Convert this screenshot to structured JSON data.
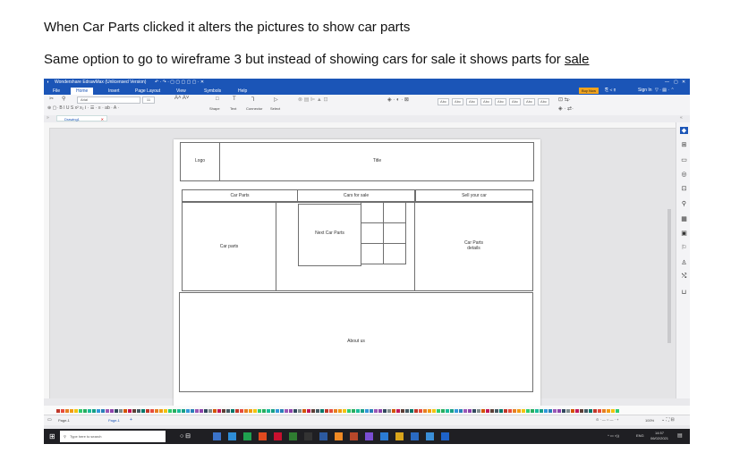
{
  "doc": {
    "line1": "When Car Parts clicked it alters the pictures to show car parts",
    "line2_pre": "Same option to go to wireframe 3 but instead of showing cars for sale it shows parts for ",
    "line2_ul": "sale"
  },
  "app": {
    "title": "Wondershare EdrawMax (Unlicensed Version)",
    "menu": [
      "File",
      "Home",
      "Insert",
      "Page Layout",
      "View",
      "Symbols",
      "Help"
    ],
    "buy_now": "Buy Now",
    "sign_in": "Sign In",
    "font_name": "Arial",
    "font_size": "11",
    "tools": [
      "Shape",
      "Text",
      "Connector",
      "Select"
    ],
    "doc_tab": "Drawing1",
    "page_tab_1": "Page-1",
    "page_tab_2": "Page-1",
    "zoom": "100%"
  },
  "wireframe": {
    "logo": "Logo",
    "title": "Title",
    "nav": [
      "Car Parts",
      "Cars for sale",
      "Sell your car"
    ],
    "car_parts": "Car parts",
    "next_car_parts": "Next Car Parts",
    "car_parts_details": "Car Parts\ndetails",
    "about_us": "About us"
  },
  "taskbar": {
    "search_placeholder": "Type here to search",
    "time": "14:57",
    "date": "06/02/2021",
    "lang": "ENG"
  }
}
